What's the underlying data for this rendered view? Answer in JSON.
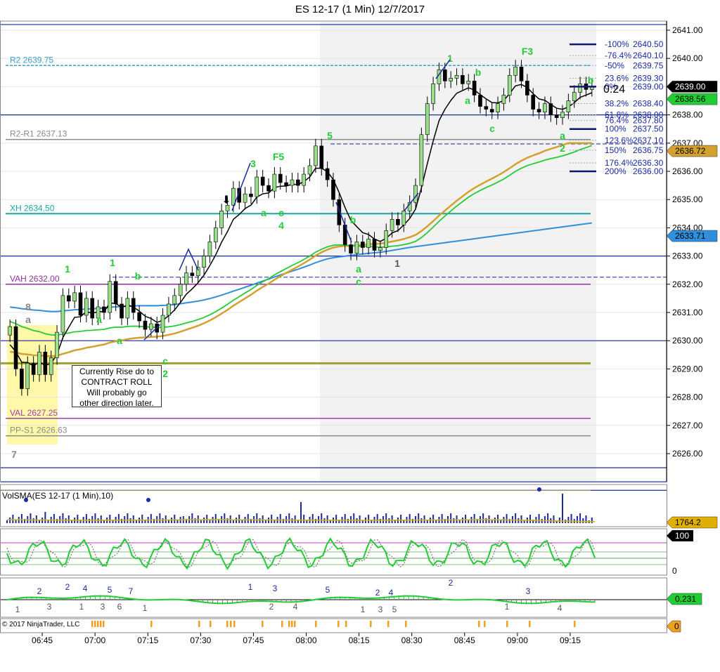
{
  "window": {
    "title": "ES 12-17 (1 Min)  12/7/2017",
    "copyright": "© 2017 NinjaTrader, LLC"
  },
  "chart_data": [
    {
      "type": "candlestick",
      "title": "ES 12-17 (1 Min)  12/7/2017",
      "x_ticks": [
        "06:45",
        "07:00",
        "07:15",
        "07:30",
        "07:45",
        "08:00",
        "08:15",
        "08:30",
        "08:45",
        "09:00",
        "09:15"
      ],
      "x_range": [
        "06:35",
        "09:22"
      ],
      "ylim": [
        2625.0,
        2641.5
      ],
      "y_ticks": [
        2641.0,
        2640.0,
        2639.0,
        2638.0,
        2637.0,
        2636.0,
        2635.0,
        2634.0,
        2633.0,
        2632.0,
        2631.0,
        2630.0,
        2629.0,
        2628.0,
        2627.0,
        2626.0
      ],
      "last_price": 2639.0,
      "right_labels": [
        {
          "text": "2639.00",
          "value": 2639.0,
          "color": "#000000"
        },
        {
          "text": "2638.56",
          "value": 2638.56,
          "color": "#22cc33"
        },
        {
          "text": "2636.72",
          "value": 2636.72,
          "color": "#d4a030"
        },
        {
          "text": "2633.71",
          "value": 2633.71,
          "color": "#2f8fdd"
        }
      ],
      "levels": [
        {
          "label": "R2 2639.75",
          "value": 2639.75,
          "color": "#3aa0c8",
          "dash": true
        },
        {
          "label": "R2-R1 2637.13",
          "value": 2637.13,
          "color": "#8a8a8a",
          "dash": false
        },
        {
          "label": "XH 2634.50",
          "value": 2634.5,
          "color": "#18a5a5",
          "dash": false
        },
        {
          "label": "VAH 2632.00",
          "value": 2632.0,
          "color": "#9030a0",
          "dash": false
        },
        {
          "label": "VAL 2627.25",
          "value": 2627.25,
          "color": "#a040b0",
          "dash": false
        },
        {
          "label": "PP-S1 2626.63",
          "value": 2626.63,
          "color": "#8a8a8a",
          "dash": false
        }
      ],
      "fib_levels": [
        {
          "label": "-100%",
          "value": 2640.5
        },
        {
          "label": "-76.4%",
          "value": 2640.1
        },
        {
          "label": "-50%",
          "value": 2639.75
        },
        {
          "label": "23.6%",
          "value": 2639.3
        },
        {
          "label": "0%",
          "value": 2639.0
        },
        {
          "label": "38.2%",
          "value": 2638.4
        },
        {
          "label": "61.8%",
          "value": 2638.0
        },
        {
          "label": "76.4%",
          "value": 2637.8
        },
        {
          "label": "100%",
          "value": 2637.5
        },
        {
          "label": "123.6%",
          "value": 2637.1
        },
        {
          "label": "150%",
          "value": 2636.75
        },
        {
          "label": "176.4%",
          "value": 2636.3
        },
        {
          "label": "200%",
          "value": 2636.0
        }
      ],
      "timer": "0:24",
      "wave_labels": [
        "1",
        "1",
        "b",
        "a",
        "a",
        "c",
        "2",
        "3",
        "F5",
        "a",
        "c",
        "4",
        "5",
        "b",
        "a",
        "c",
        "1",
        "1",
        "b",
        "a",
        "c",
        "F3",
        "b",
        "a",
        "2",
        "8",
        "a",
        "7"
      ],
      "series": [
        {
          "name": "ES 12-17 (1 Min)",
          "close": [
            2630.5,
            2629.0,
            2628.3,
            2629.2,
            2628.8,
            2629.6,
            2628.8,
            2629.4,
            2630.3,
            2631.6,
            2631.4,
            2631.7,
            2630.9,
            2631.5,
            2630.8,
            2631.2,
            2631.0,
            2632.1,
            2631.3,
            2630.8,
            2631.5,
            2631.0,
            2630.7,
            2630.4,
            2630.6,
            2630.3,
            2630.9,
            2631.3,
            2631.6,
            2632.0,
            2632.4,
            2632.3,
            2632.6,
            2633.0,
            2633.5,
            2634.0,
            2634.6,
            2634.8,
            2635.4,
            2634.9,
            2635.2,
            2635.1,
            2635.8,
            2635.5,
            2635.3,
            2635.9,
            2635.6,
            2635.5,
            2635.7,
            2635.5,
            2635.9,
            2636.2,
            2636.9,
            2636.1,
            2635.7,
            2635.0,
            2634.1,
            2633.4,
            2633.1,
            2633.5,
            2633.3,
            2633.6,
            2633.2,
            2633.3,
            2633.9,
            2634.3,
            2634.1,
            2634.6,
            2634.9,
            2635.5,
            2637.3,
            2638.4,
            2639.1,
            2639.6,
            2639.2,
            2639.3,
            2639.4,
            2639.1,
            2639.2,
            2638.7,
            2638.3,
            2638.2,
            2638.1,
            2638.4,
            2638.7,
            2639.4,
            2639.7,
            2639.2,
            2638.7,
            2638.2,
            2638.1,
            2638.4,
            2638.0,
            2637.9,
            2638.1,
            2638.5,
            2638.8,
            2639.1,
            2638.9,
            2639.0
          ]
        },
        {
          "name": "VolSMA(ES 12-17 (1 Min),10)",
          "label": "VolSMA(ES 12-17 (1 Min),10)",
          "last": "1764.2"
        },
        {
          "name": "Oscillator",
          "last": "100",
          "ticks": [
            "100",
            "0"
          ]
        },
        {
          "name": "Histogram",
          "last": "0.231",
          "labels": [
            "1",
            "2",
            "3",
            "2",
            "1",
            "4",
            "3",
            "5",
            "6",
            "7",
            "1",
            "1",
            "2",
            "3",
            "4",
            "5",
            "1",
            "2",
            "3",
            "4",
            "5",
            "2",
            "1",
            "3",
            "4"
          ]
        },
        {
          "name": "Events",
          "last": "0"
        }
      ]
    }
  ],
  "annotation": {
    "lines": [
      "Currently Rise do to",
      "CONTRACT ROLL",
      "Will probably go",
      "other direction later."
    ]
  }
}
